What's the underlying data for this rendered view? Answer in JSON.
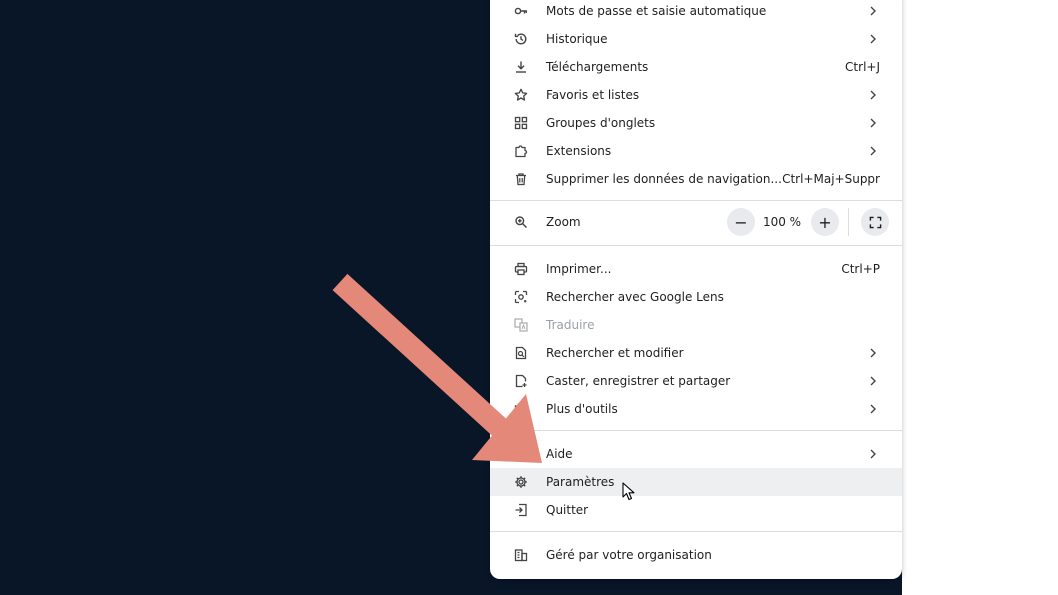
{
  "menu": {
    "items_top": [
      {
        "label": "Mots de passe et saisie automatique",
        "icon": "key-icon",
        "chevron": true
      },
      {
        "label": "Historique",
        "icon": "history-icon",
        "chevron": true
      },
      {
        "label": "Téléchargements",
        "icon": "download-icon",
        "shortcut": "Ctrl+J"
      },
      {
        "label": "Favoris et listes",
        "icon": "star-icon",
        "chevron": true
      },
      {
        "label": "Groupes d'onglets",
        "icon": "tab-groups-icon",
        "chevron": true
      },
      {
        "label": "Extensions",
        "icon": "extension-icon",
        "chevron": true
      },
      {
        "label": "Supprimer les données de navigation...",
        "icon": "trash-icon",
        "shortcut": "Ctrl+Maj+Suppr"
      }
    ],
    "zoom": {
      "label": "Zoom",
      "value": "100 %",
      "minus": "−",
      "plus": "+"
    },
    "items_mid": [
      {
        "label": "Imprimer...",
        "icon": "print-icon",
        "shortcut": "Ctrl+P"
      },
      {
        "label": "Rechercher avec Google Lens",
        "icon": "lens-icon"
      },
      {
        "label": "Traduire",
        "icon": "translate-icon",
        "disabled": true
      },
      {
        "label": "Rechercher et modifier",
        "icon": "find-icon",
        "chevron": true
      },
      {
        "label": "Caster, enregistrer et partager",
        "icon": "cast-icon",
        "chevron": true
      },
      {
        "label": "Plus d'outils",
        "icon": "tools-icon",
        "chevron": true
      }
    ],
    "items_bottom": [
      {
        "label": "Aide",
        "icon": "help-icon",
        "chevron": true
      },
      {
        "label": "Paramètres",
        "icon": "gear-icon",
        "hovered": true
      },
      {
        "label": "Quitter",
        "icon": "exit-icon"
      }
    ],
    "managed": {
      "label": "Géré par votre organisation",
      "icon": "building-icon"
    }
  },
  "colors": {
    "background": "#081628",
    "menu_bg": "#ffffff",
    "arrow": "#e4897a",
    "hover": "#eeeff1"
  }
}
